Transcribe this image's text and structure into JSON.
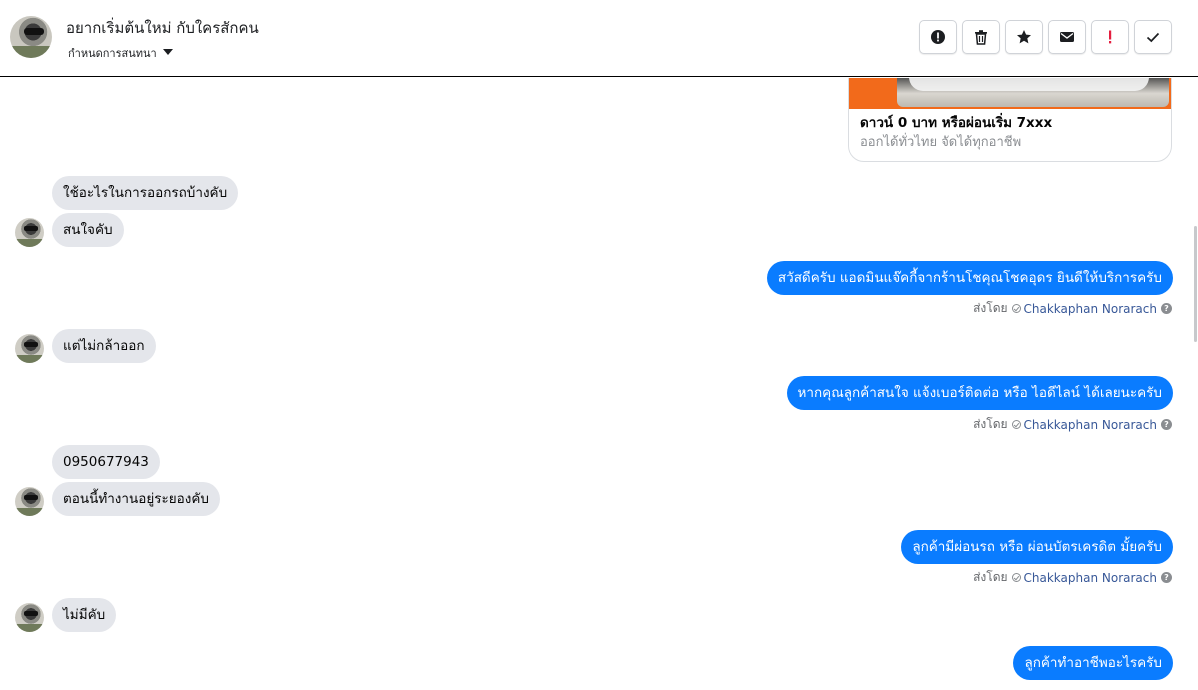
{
  "header": {
    "title": "อยากเริ่มต้นใหม่ กับใครสักคน",
    "subtitle": "กำหนดการสนทนา",
    "actions": [
      {
        "name": "report-icon"
      },
      {
        "name": "trash-icon"
      },
      {
        "name": "star-icon"
      },
      {
        "name": "mail-icon"
      },
      {
        "name": "spam-icon"
      },
      {
        "name": "check-icon"
      }
    ]
  },
  "card": {
    "title": "ดาวน์ 0 บาท หรือผ่อนเริ่ม 7xxx",
    "description": "ออกได้ทั่วไทย จัดได้ทุกอาชีพ"
  },
  "messages": [
    {
      "dir": "in",
      "text": "ใช้อะไรในการออกรถบ้างคับ"
    },
    {
      "dir": "in",
      "text": "สนใจคับ"
    },
    {
      "dir": "out",
      "text": "สวัสดีครับ แอดมินแจ๊คกี้จากร้านโชคุณโชคอุดร ยินดีให้บริการครับ"
    },
    {
      "dir": "in",
      "text": "แต่ไม่กล้าออก"
    },
    {
      "dir": "out",
      "text": "หากคุณลูกค้าสนใจ แจ้งเบอร์ติดต่อ หรือ ไอดีไลน์ ได้เลยนะครับ"
    },
    {
      "dir": "in",
      "text": "0950677943"
    },
    {
      "dir": "in",
      "text": "ตอนนี้ทำงานอยู่ระยองคับ"
    },
    {
      "dir": "out",
      "text": "ลูกค้ามีผ่อนรถ หรือ ผ่อนบัตรเครดิต มั้ยครับ"
    },
    {
      "dir": "in",
      "text": "ไม่มีคับ"
    },
    {
      "dir": "out",
      "text": "ลูกค้าทำอาชีพอะไรครับ"
    }
  ],
  "sent_by": {
    "prefix": "ส่งโดย",
    "name": "Chakkaphan Norarach",
    "help": "?"
  },
  "colors": {
    "outgoing": "#0a7cff",
    "incoming": "#e4e6eb",
    "card_banner": "#f26a1b"
  }
}
